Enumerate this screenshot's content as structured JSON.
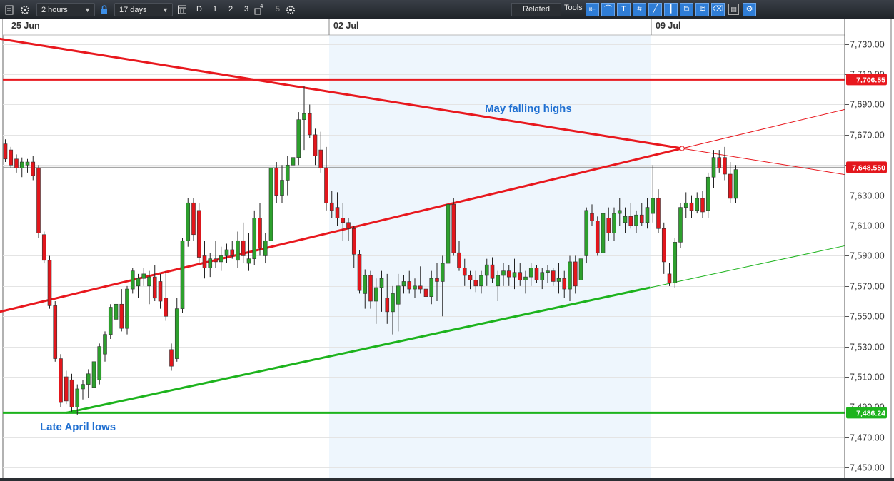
{
  "toolbar": {
    "interval": "2 hours",
    "range": "17 days",
    "period_buttons": [
      "D",
      "1",
      "2",
      "3",
      "4",
      "5"
    ],
    "related_label": "Related",
    "tools_label": "Tools"
  },
  "chart_data": {
    "type": "candlestick",
    "title": "",
    "x_date_labels": [
      "25 Jun",
      "02 Jul",
      "09 Jul"
    ],
    "y_ticks": [
      "7,730.00",
      "7,710.00",
      "7,690.00",
      "7,670.00",
      "7,650.00",
      "7,630.00",
      "7,610.00",
      "7,590.00",
      "7,570.00",
      "7,550.00",
      "7,530.00",
      "7,510.00",
      "7,490.00",
      "7,470.00",
      "7,450.00"
    ],
    "ylim": [
      7443,
      7736
    ],
    "grid": true,
    "current_price_label": "7,648.550",
    "current_price": 7648.55,
    "horizontal_levels": [
      {
        "value": 7706.55,
        "label": "7,706.55",
        "color": "#e8181e"
      },
      {
        "value": 7486.24,
        "label": "7,486.24",
        "color": "#1db31d"
      }
    ],
    "annotations": [
      {
        "text": "May falling highs",
        "color": "#1f6fd1"
      },
      {
        "text": "Late April lows",
        "color": "#1f6fd1"
      }
    ],
    "colors": {
      "up": "#2da02d",
      "down": "#e3161c",
      "resistance": "#e8181e",
      "support": "#1db31d",
      "week_shade": "#eef6fd"
    },
    "candles_ohlc": [
      [
        7664,
        7667,
        7652,
        7654
      ],
      [
        7660,
        7662,
        7648,
        7650
      ],
      [
        7654,
        7657,
        7645,
        7648
      ],
      [
        7648,
        7655,
        7642,
        7652
      ],
      [
        7650,
        7654,
        7645,
        7652
      ],
      [
        7652,
        7656,
        7640,
        7643
      ],
      [
        7648,
        7650,
        7602,
        7605
      ],
      [
        7604,
        7606,
        7585,
        7587
      ],
      [
        7587,
        7590,
        7555,
        7557
      ],
      [
        7557,
        7560,
        7520,
        7522
      ],
      [
        7522,
        7525,
        7490,
        7493
      ],
      [
        7510,
        7514,
        7492,
        7494
      ],
      [
        7508,
        7512,
        7487,
        7490
      ],
      [
        7490,
        7505,
        7485,
        7502
      ],
      [
        7502,
        7508,
        7495,
        7505
      ],
      [
        7505,
        7515,
        7496,
        7512
      ],
      [
        7503,
        7522,
        7500,
        7520
      ],
      [
        7508,
        7532,
        7505,
        7530
      ],
      [
        7525,
        7540,
        7520,
        7538
      ],
      [
        7538,
        7558,
        7535,
        7556
      ],
      [
        7548,
        7560,
        7545,
        7558
      ],
      [
        7558,
        7568,
        7540,
        7542
      ],
      [
        7542,
        7570,
        7538,
        7568
      ],
      [
        7568,
        7582,
        7565,
        7580
      ],
      [
        7570,
        7578,
        7562,
        7575
      ],
      [
        7575,
        7582,
        7570,
        7578
      ],
      [
        7570,
        7580,
        7558,
        7576
      ],
      [
        7576,
        7584,
        7560,
        7562
      ],
      [
        7573,
        7578,
        7555,
        7560
      ],
      [
        7562,
        7580,
        7547,
        7550
      ],
      [
        7528,
        7532,
        7514,
        7517
      ],
      [
        7522,
        7562,
        7520,
        7555
      ],
      [
        7555,
        7602,
        7552,
        7600
      ],
      [
        7600,
        7628,
        7596,
        7625
      ],
      [
        7625,
        7628,
        7600,
        7604
      ],
      [
        7620,
        7625,
        7585,
        7589
      ],
      [
        7590,
        7600,
        7575,
        7582
      ],
      [
        7582,
        7592,
        7576,
        7588
      ],
      [
        7588,
        7600,
        7582,
        7586
      ],
      [
        7586,
        7596,
        7580,
        7590
      ],
      [
        7590,
        7598,
        7585,
        7594
      ],
      [
        7594,
        7600,
        7588,
        7590
      ],
      [
        7587,
        7606,
        7582,
        7600
      ],
      [
        7600,
        7612,
        7585,
        7590
      ],
      [
        7585,
        7605,
        7580,
        7588
      ],
      [
        7588,
        7620,
        7584,
        7615
      ],
      [
        7615,
        7625,
        7590,
        7595
      ],
      [
        7590,
        7605,
        7585,
        7600
      ],
      [
        7600,
        7650,
        7595,
        7648
      ],
      [
        7648,
        7652,
        7625,
        7630
      ],
      [
        7630,
        7650,
        7625,
        7640
      ],
      [
        7640,
        7656,
        7630,
        7650
      ],
      [
        7650,
        7668,
        7635,
        7655
      ],
      [
        7655,
        7685,
        7650,
        7680
      ],
      [
        7680,
        7702,
        7660,
        7684
      ],
      [
        7684,
        7690,
        7668,
        7670
      ],
      [
        7670,
        7674,
        7650,
        7656
      ],
      [
        7660,
        7672,
        7645,
        7648
      ],
      [
        7648,
        7662,
        7620,
        7625
      ],
      [
        7625,
        7633,
        7615,
        7620
      ],
      [
        7622,
        7632,
        7610,
        7615
      ],
      [
        7615,
        7625,
        7600,
        7612
      ],
      [
        7612,
        7615,
        7600,
        7608
      ],
      [
        7608,
        7610,
        7582,
        7591
      ],
      [
        7591,
        7594,
        7565,
        7567
      ],
      [
        7565,
        7581,
        7555,
        7577
      ],
      [
        7577,
        7580,
        7555,
        7560
      ],
      [
        7560,
        7575,
        7545,
        7569
      ],
      [
        7569,
        7580,
        7553,
        7575
      ],
      [
        7562,
        7578,
        7545,
        7553
      ],
      [
        7553,
        7570,
        7538,
        7565
      ],
      [
        7558,
        7578,
        7540,
        7570
      ],
      [
        7570,
        7577,
        7565,
        7573
      ],
      [
        7573,
        7580,
        7565,
        7568
      ],
      [
        7568,
        7575,
        7562,
        7570
      ],
      [
        7570,
        7583,
        7565,
        7568
      ],
      [
        7568,
        7575,
        7560,
        7563
      ],
      [
        7563,
        7580,
        7558,
        7575
      ],
      [
        7575,
        7585,
        7560,
        7573
      ],
      [
        7573,
        7590,
        7550,
        7585
      ],
      [
        7585,
        7632,
        7575,
        7624
      ],
      [
        7624,
        7628,
        7590,
        7592
      ],
      [
        7592,
        7600,
        7580,
        7582
      ],
      [
        7582,
        7588,
        7570,
        7577
      ],
      [
        7577,
        7580,
        7568,
        7574
      ],
      [
        7574,
        7580,
        7566,
        7570
      ],
      [
        7570,
        7580,
        7565,
        7577
      ],
      [
        7577,
        7588,
        7570,
        7584
      ],
      [
        7584,
        7589,
        7572,
        7575
      ],
      [
        7570,
        7580,
        7560,
        7577
      ],
      [
        7577,
        7585,
        7570,
        7580
      ],
      [
        7580,
        7584,
        7570,
        7576
      ],
      [
        7576,
        7588,
        7568,
        7579
      ],
      [
        7579,
        7585,
        7570,
        7574
      ],
      [
        7574,
        7580,
        7565,
        7576
      ],
      [
        7576,
        7585,
        7570,
        7582
      ],
      [
        7582,
        7584,
        7572,
        7574
      ],
      [
        7574,
        7582,
        7568,
        7579
      ],
      [
        7579,
        7584,
        7572,
        7580
      ],
      [
        7580,
        7582,
        7570,
        7573
      ],
      [
        7573,
        7585,
        7565,
        7575
      ],
      [
        7575,
        7580,
        7562,
        7568
      ],
      [
        7568,
        7590,
        7560,
        7586
      ],
      [
        7586,
        7590,
        7565,
        7570
      ],
      [
        7574,
        7590,
        7568,
        7588
      ],
      [
        7590,
        7622,
        7585,
        7620
      ],
      [
        7618,
        7624,
        7610,
        7613
      ],
      [
        7613,
        7616,
        7590,
        7592
      ],
      [
        7592,
        7620,
        7585,
        7618
      ],
      [
        7615,
        7622,
        7600,
        7605
      ],
      [
        7605,
        7622,
        7600,
        7618
      ],
      [
        7618,
        7628,
        7610,
        7620
      ],
      [
        7612,
        7622,
        7605,
        7616
      ],
      [
        7616,
        7625,
        7608,
        7610
      ],
      [
        7610,
        7620,
        7605,
        7617
      ],
      [
        7617,
        7625,
        7610,
        7612
      ],
      [
        7612,
        7628,
        7608,
        7622
      ],
      [
        7618,
        7650,
        7612,
        7628
      ],
      [
        7628,
        7634,
        7605,
        7608
      ],
      [
        7608,
        7612,
        7578,
        7586
      ],
      [
        7578,
        7585,
        7570,
        7572
      ],
      [
        7572,
        7602,
        7569,
        7599
      ],
      [
        7599,
        7625,
        7595,
        7622
      ],
      [
        7622,
        7632,
        7615,
        7625
      ],
      [
        7625,
        7630,
        7615,
        7620
      ],
      [
        7620,
        7632,
        7618,
        7628
      ],
      [
        7628,
        7633,
        7615,
        7619
      ],
      [
        7620,
        7645,
        7615,
        7642
      ],
      [
        7642,
        7660,
        7635,
        7655
      ],
      [
        7655,
        7660,
        7645,
        7648
      ],
      [
        7655,
        7662,
        7640,
        7644
      ],
      [
        7644,
        7652,
        7625,
        7628
      ],
      [
        7628,
        7650,
        7625,
        7647
      ]
    ],
    "trendlines": [
      {
        "name": "May falling highs",
        "from": [
          -1,
          7733.5
        ],
        "to": [
          122.3,
          7661
        ]
      },
      {
        "name": "rising resistance",
        "from": [
          -1,
          7553
        ],
        "to": [
          122.3,
          7661
        ]
      },
      {
        "name": "rising support",
        "from": [
          11,
          7486.2
        ],
        "to": [
          116.5,
          7569
        ]
      }
    ]
  }
}
